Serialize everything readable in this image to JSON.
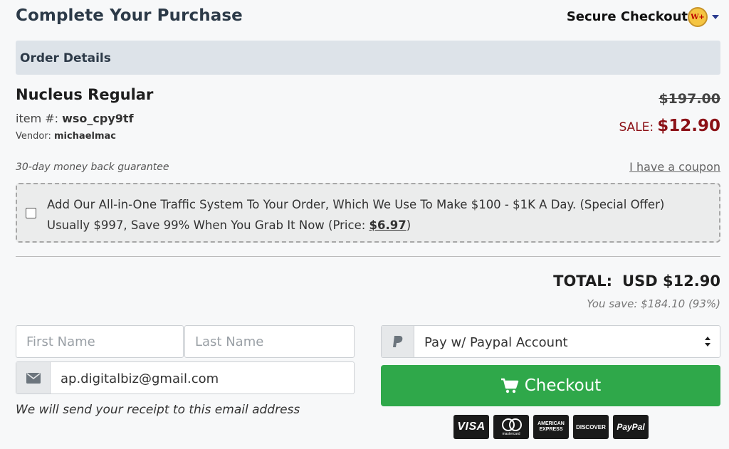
{
  "header": {
    "title": "Complete Your Purchase",
    "secure_label": "Secure Checkout",
    "logo_text": "W+"
  },
  "order": {
    "section_title": "Order Details",
    "product_name": "Nucleus Regular",
    "item_label": "item #:",
    "item_id": "wso_cpy9tf",
    "vendor_label": "Vendor:",
    "vendor_name": "michaelmac",
    "original_price": "$197.00",
    "sale_label": "SALE:",
    "sale_price": "$12.90",
    "guarantee": "30-day money back guarantee",
    "coupon_link": "I have a coupon"
  },
  "offer": {
    "checked": false,
    "text": "Add Our All-in-One Traffic System To Your Order, Which We Use To Make $100 - $1K A Day. (Special Offer) Usually $997, Save 99% When You Grab It Now (Price: ",
    "price": "$6.97",
    "suffix": ")"
  },
  "summary": {
    "total_label": "TOTAL:",
    "total_value": "USD $12.90",
    "savings": "You save: $184.10 (93%)"
  },
  "form": {
    "first_name_placeholder": "First Name",
    "last_name_placeholder": "Last Name",
    "email_value": "ap.digitalbiz@gmail.com",
    "receipt_note": "We will send your receipt to this email address",
    "payment_selected": "Pay w/ Paypal Account",
    "checkout_label": "Checkout"
  },
  "payment_cards": [
    {
      "name": "visa",
      "label": "VISA"
    },
    {
      "name": "mastercard",
      "label": "mastercard"
    },
    {
      "name": "amex",
      "label": "AMERICAN EXPRESS"
    },
    {
      "name": "discover",
      "label": "DISCOVER"
    },
    {
      "name": "paypal",
      "label": "PayPal"
    }
  ],
  "colors": {
    "accent_green": "#2fa84a",
    "sale_red": "#8b1016",
    "title_navy": "#2c3a48"
  }
}
